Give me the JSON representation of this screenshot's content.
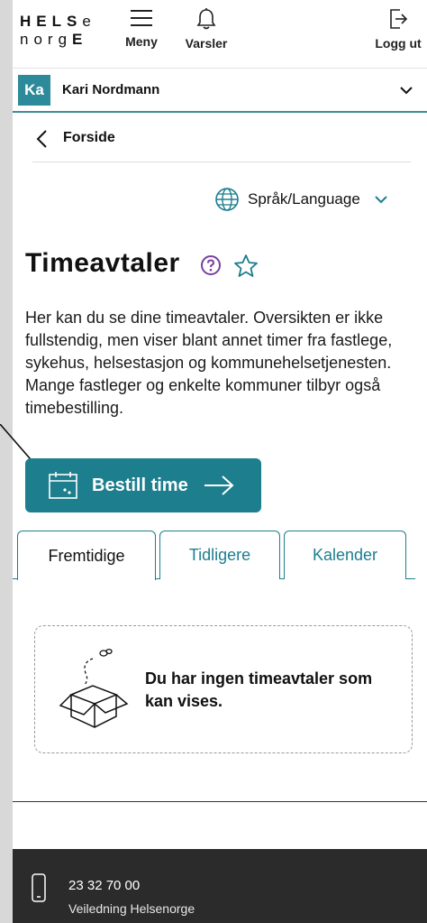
{
  "header": {
    "logo_line1": "HELSe",
    "logo_line2": "norgE",
    "menu_label": "Meny",
    "alerts_label": "Varsler",
    "logout_label": "Logg ut"
  },
  "user": {
    "initials": "Ka",
    "name": "Kari Nordmann"
  },
  "breadcrumb": {
    "back_label": "Forside"
  },
  "language": {
    "label": "Språk/Language"
  },
  "page": {
    "title": "Timeavtaler",
    "intro": "Her kan du se dine timeavtaler. Oversikten er ikke fullstendig, men viser blant annet timer fra fastlege, sykehus, helsestasjon og kommunehelsetjenesten. Mange fastleger og enkelte kommuner tilbyr også timebestilling."
  },
  "booking": {
    "label": "Bestill time"
  },
  "tabs": [
    {
      "label": "Fremtidige",
      "active": true
    },
    {
      "label": "Tidligere",
      "active": false
    },
    {
      "label": "Kalender",
      "active": false
    }
  ],
  "empty_state": {
    "message": "Du har ingen timeavtaler som kan vises."
  },
  "footer": {
    "phone": "23 32 70 00",
    "subtitle": "Veiledning Helsenorge"
  },
  "colors": {
    "accent": "#1d7e8d",
    "help_icon": "#7a3fa0",
    "footer_bg": "#2b2b2b"
  },
  "icons": [
    "hamburger-icon",
    "bell-icon",
    "logout-icon",
    "chevron-down-icon",
    "chevron-left-icon",
    "globe-icon",
    "help-icon",
    "star-icon",
    "calendar-icon",
    "arrow-right-icon",
    "empty-box-icon",
    "phone-icon"
  ]
}
